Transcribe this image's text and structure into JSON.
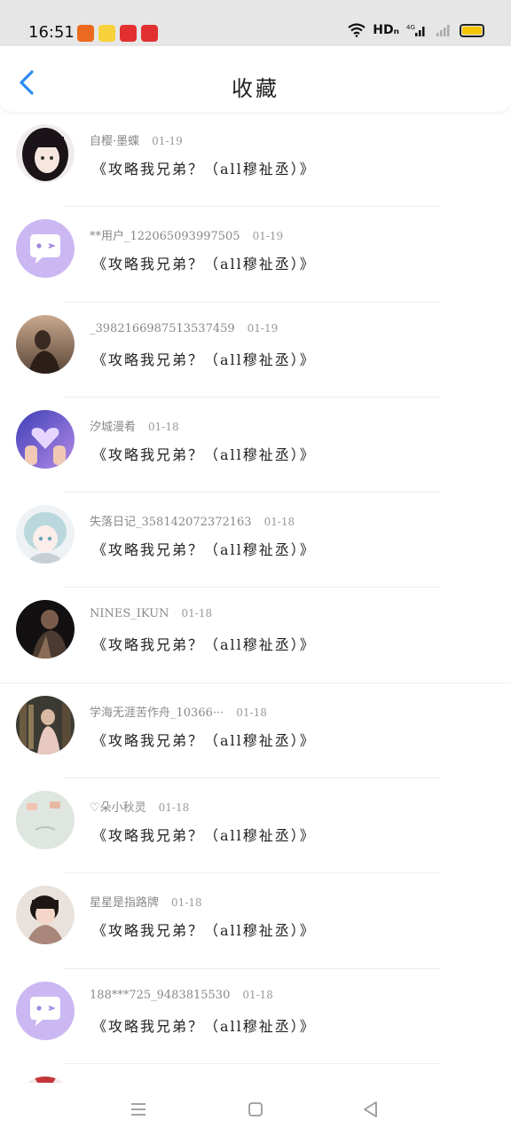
{
  "status_bar": {
    "time": "16:51",
    "network": "HDₙ",
    "cell": "4G",
    "notifications": [
      {
        "name": "taobao-app-icon",
        "color": "#ec6a1f"
      },
      {
        "name": "meituan-app-icon",
        "color": "#f7d23a"
      },
      {
        "name": "pinduoduo-app-icon",
        "color": "#e23030"
      },
      {
        "name": "pinduoduo-app-icon-2",
        "color": "#e23030"
      }
    ],
    "battery_color": "#f2c500"
  },
  "header": {
    "title": "收藏",
    "back_color": "#2b8cf0"
  },
  "favorites": [
    {
      "user": "自樱·墨蝶",
      "date": "01-19",
      "title": "《攻略我兄弟？（all穆祉丞）》",
      "avatar": "anime-girl-dark"
    },
    {
      "user": "**用户_122065093997505",
      "date": "01-19",
      "title": "《攻略我兄弟？（all穆祉丞）》",
      "avatar": "default-chat"
    },
    {
      "user": "_3982166987513537459",
      "date": "01-19",
      "title": "《攻略我兄弟？（all穆祉丞）》",
      "avatar": "photo-sunset"
    },
    {
      "user": "汐城漫肴",
      "date": "01-18",
      "title": "《攻略我兄弟？（all穆祉丞）》",
      "avatar": "photo-heart-hands"
    },
    {
      "user": "失落日记_3581420723721​63",
      "date": "01-18",
      "title": "《攻略我兄弟？（all穆祉丞）》",
      "avatar": "anime-teal-hair"
    },
    {
      "user": "NINES_IKUN",
      "date": "01-18",
      "title": "《攻略我兄弟？（all穆祉丞）》",
      "avatar": "photo-dark"
    },
    {
      "user": "学海无涯苦作舟_10366···",
      "date": "01-18",
      "title": "《攻略我兄弟？（all穆祉丞）》",
      "avatar": "photo-library"
    },
    {
      "user": "♡朵小秋灵",
      "date": "01-18",
      "title": "《攻略我兄弟？（all穆祉丞）》",
      "avatar": "photo-mint"
    },
    {
      "user": "星星是指路牌",
      "date": "01-18",
      "title": "《攻略我兄弟？（all穆祉丞）》",
      "avatar": "photo-boy"
    },
    {
      "user": "188***725_9483815530",
      "date": "01-18",
      "title": "《攻略我兄弟？（all穆祉丞）》",
      "avatar": "default-chat"
    }
  ],
  "nav_bar": {
    "menu_icon": "menu-icon",
    "home_icon": "home-square-icon",
    "back_icon": "back-triangle-icon"
  }
}
